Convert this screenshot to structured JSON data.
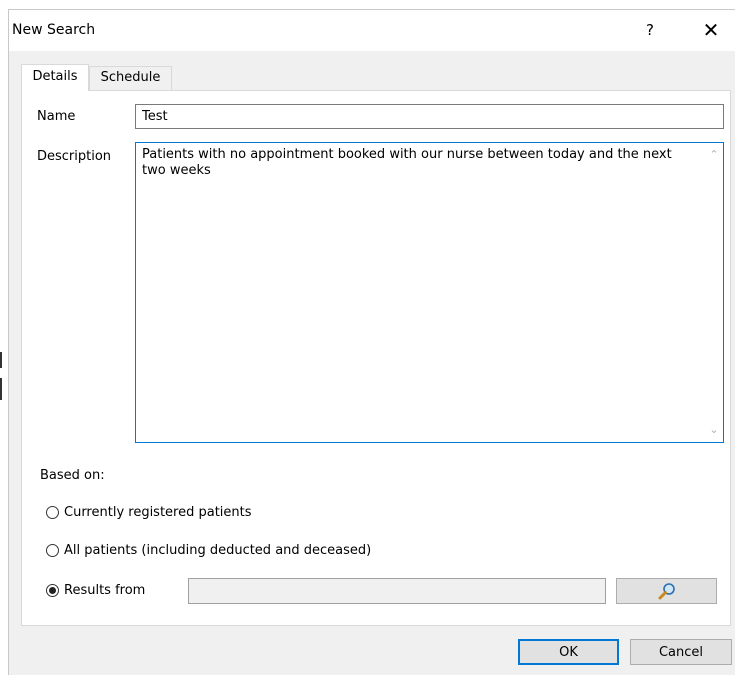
{
  "window": {
    "title": "New Search",
    "help_glyph": "?",
    "close_glyph": "✕"
  },
  "tabs": [
    {
      "label": "Details",
      "active": true
    },
    {
      "label": "Schedule",
      "active": false
    }
  ],
  "form": {
    "name_label": "Name",
    "name_value": "Test",
    "description_label": "Description",
    "description_value": "Patients with no appointment booked with our nurse between today and the next two weeks",
    "based_on_label": "Based on:",
    "options": [
      {
        "label": "Currently registered patients",
        "selected": false
      },
      {
        "label": "All patients (including deducted and deceased)",
        "selected": false
      },
      {
        "label": "Results from",
        "selected": true
      }
    ],
    "results_from_value": ""
  },
  "buttons": {
    "ok": "OK",
    "cancel": "Cancel"
  },
  "icons": {
    "search": "magnifier-icon"
  },
  "colors": {
    "focus_border": "#0078d7",
    "dialog_bg": "#f0f0f0"
  }
}
